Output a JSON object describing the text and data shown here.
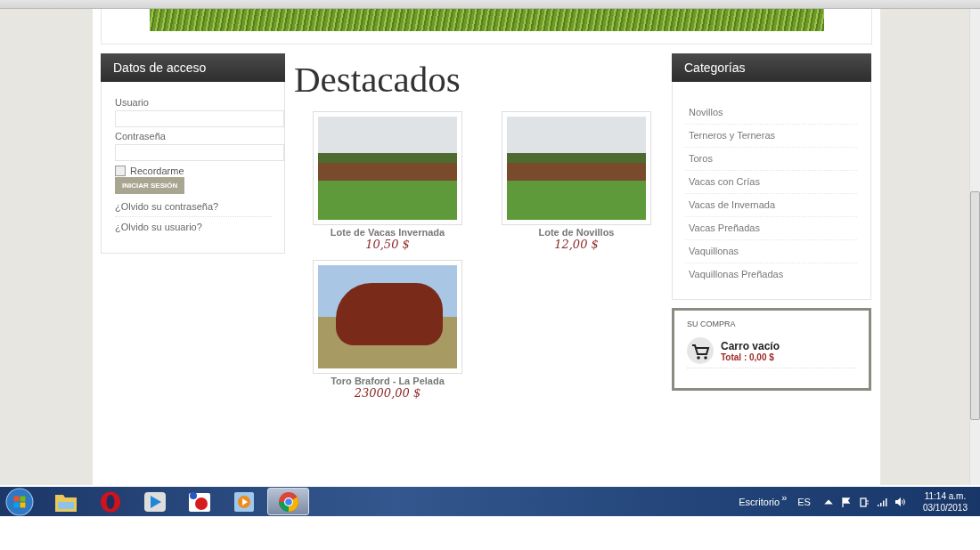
{
  "login": {
    "title": "Datos de acceso",
    "username_label": "Usuario",
    "password_label": "Contraseña",
    "remember": {
      "label": "Recordarme",
      "checked": false
    },
    "submit": "INICIAR SESIÓN",
    "links": [
      "¿Olvido su contraseña?",
      "¿Olvido su usuario?"
    ]
  },
  "featured": {
    "title": "Destacados",
    "products": [
      {
        "name": "Lote de Vacas Invernada",
        "price": "10,50 $",
        "kind": "herd"
      },
      {
        "name": "Lote de Novillos",
        "price": "12,00 $",
        "kind": "herd"
      },
      {
        "name": "Toro Braford - La Pelada",
        "price": "23000,00 $",
        "kind": "bull"
      }
    ]
  },
  "categories": {
    "title": "Categorías",
    "items": [
      "Novillos",
      "Terneros y Terneras",
      "Toros",
      "Vacas con Crías",
      "Vacas de Invernada",
      "Vacas Preñadas",
      "Vaquillonas",
      "Vaquillonas Preñadas"
    ]
  },
  "cart": {
    "title": "SU COMPRA",
    "status": "Carro vacío",
    "total": "Total : 0,00 $"
  },
  "taskbar": {
    "apps": [
      {
        "kind": "folder",
        "selected": false
      },
      {
        "kind": "opera",
        "selected": false
      },
      {
        "kind": "player",
        "selected": false
      },
      {
        "kind": "paint",
        "selected": false
      },
      {
        "kind": "video",
        "selected": false
      },
      {
        "kind": "chrome",
        "selected": true
      }
    ],
    "toolbar": "Escritorio",
    "toolbar_more": "»",
    "language": "ES",
    "time": "11:14 a.m.",
    "date": "03/10/2013"
  }
}
